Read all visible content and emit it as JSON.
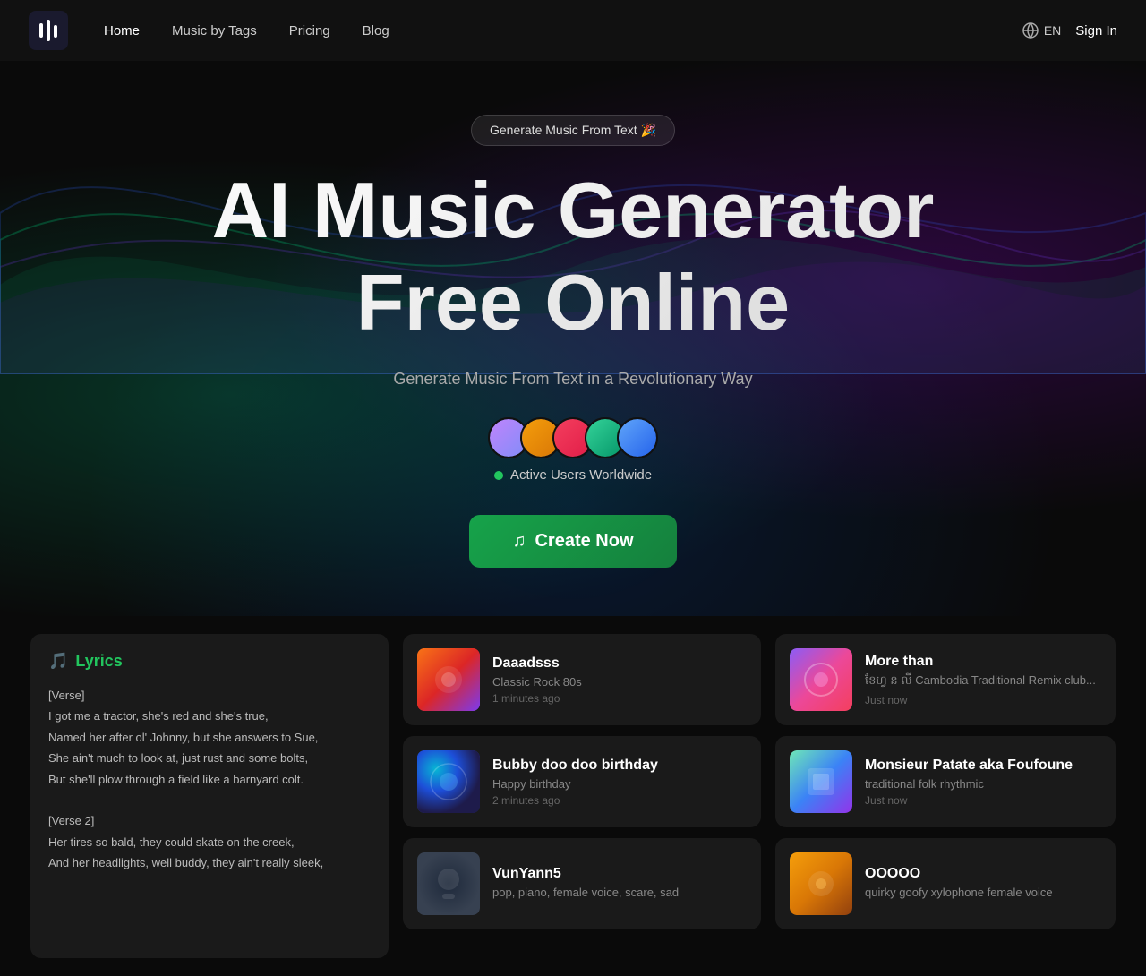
{
  "nav": {
    "logo_icon": "♫",
    "links": [
      {
        "label": "Home",
        "href": "#",
        "active": true
      },
      {
        "label": "Music by Tags",
        "href": "#",
        "active": false
      },
      {
        "label": "Pricing",
        "href": "#",
        "active": false
      },
      {
        "label": "Blog",
        "href": "#",
        "active": false
      }
    ],
    "lang": "EN",
    "sign_in": "Sign In"
  },
  "hero": {
    "badge_text": "Generate Music From Text 🎉",
    "title_line1": "AI Music Generator",
    "title_line2": "Free Online",
    "subtitle": "Generate Music From Text in a Revolutionary Way",
    "active_users_label": "Active Users Worldwide",
    "create_btn": "Create Now"
  },
  "music_cards": [
    {
      "id": 1,
      "title": "Daaadsss",
      "genre": "Classic Rock 80s",
      "time": "1 minutes ago",
      "thumb_class": "th1"
    },
    {
      "id": 2,
      "title": "Bubby doo doo birthday",
      "genre": "Happy birthday",
      "time": "2 minutes ago",
      "thumb_class": "th3"
    },
    {
      "id": 3,
      "title": "VunYann5",
      "genre": "pop, piano, female voice, scare, sad",
      "time": "",
      "thumb_class": "th5"
    },
    {
      "id": 4,
      "title": "More than",
      "genre": "ខែហ្វ ន លី Cambodia Traditional Remix club...",
      "time": "Just now",
      "thumb_class": "th2"
    },
    {
      "id": 5,
      "title": "Monsieur Patate aka Foufoune",
      "genre": "traditional folk rhythmic",
      "time": "Just now",
      "thumb_class": "th4"
    },
    {
      "id": 6,
      "title": "OOOOO",
      "genre": "quirky goofy xylophone female voice",
      "time": "",
      "thumb_class": "th6"
    }
  ],
  "lyrics": {
    "title": "Lyrics",
    "content": "[Verse]\nI got me a tractor, she's red and she's true,\nNamed her after ol' Johnny, but she answers to Sue,\nShe ain't much to look at, just rust and some bolts,\nBut she'll plow through a field like a barnyard colt.\n\n[Verse 2]\nHer tires so bald, they could skate on the creek,\nAnd her headlights, well buddy, they ain't really sleek,"
  },
  "avatars": [
    {
      "class": "av1",
      "label": "User 1"
    },
    {
      "class": "av2",
      "label": "User 2"
    },
    {
      "class": "av3",
      "label": "User 3"
    },
    {
      "class": "av4",
      "label": "User 4"
    },
    {
      "class": "av5",
      "label": "User 5"
    }
  ]
}
